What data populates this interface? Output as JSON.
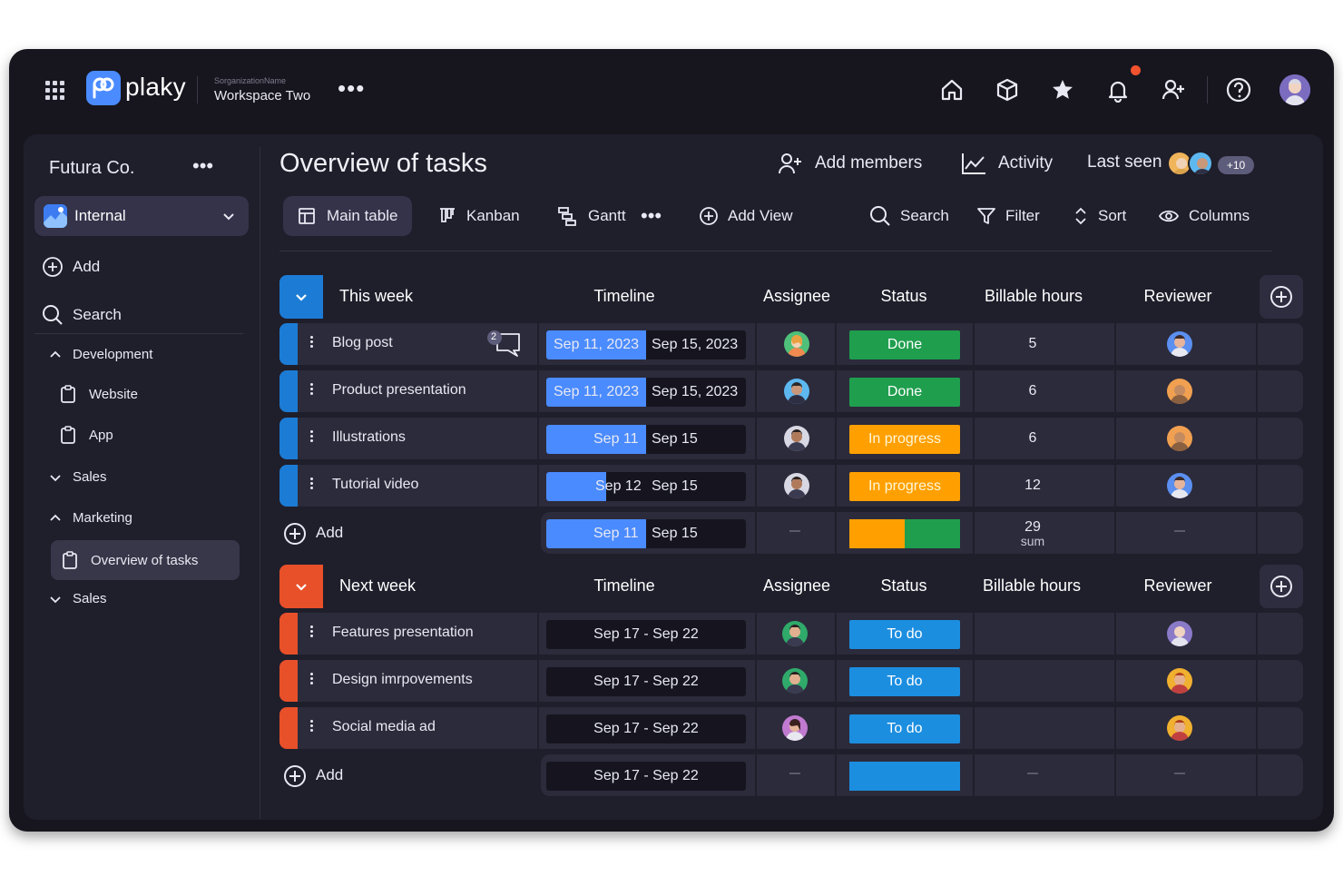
{
  "colors": {
    "accent": "#4a8bff",
    "this_week": "#1c7cd5",
    "next_week": "#e8502a",
    "done": "#1f9e4e",
    "in_progress": "#ffa000",
    "to_do": "#1c8ee0",
    "notification": "#f2522e"
  },
  "app": {
    "brand": "plaky",
    "org_label": "SorganizationName",
    "workspace_label": "Workspace Two",
    "more_icon": "more-horizontal-icon"
  },
  "topbar": {
    "icons": [
      "home-icon",
      "box-icon",
      "star-icon",
      "bell-icon",
      "add-user-icon",
      "help-icon",
      "profile-avatar"
    ]
  },
  "sidebar": {
    "company": "Futura Co.",
    "workspace": "Internal",
    "add_label": "Add",
    "search_label": "Search",
    "folders": [
      {
        "label": "Development",
        "state": "expanded",
        "boards": [
          "Website",
          "App"
        ]
      },
      {
        "label": "Sales",
        "state": "collapsed",
        "boards": []
      },
      {
        "label": "Marketing",
        "state": "expanded",
        "boards": [
          "Overview of tasks"
        ]
      },
      {
        "label": "Sales",
        "state": "collapsed",
        "boards": []
      }
    ],
    "active_board": "Overview of tasks"
  },
  "header": {
    "title": "Overview of tasks",
    "add_members": "Add members",
    "activity": "Activity",
    "last_seen": "Last seen",
    "last_seen_more": "+10"
  },
  "views": {
    "tabs": [
      {
        "label": "Main table",
        "active": true,
        "icon": "table-icon"
      },
      {
        "label": "Kanban",
        "active": false,
        "icon": "kanban-icon"
      },
      {
        "label": "Gantt",
        "active": false,
        "icon": "gantt-icon"
      }
    ],
    "add_view": "Add View",
    "search": "Search",
    "filter": "Filter",
    "sort": "Sort",
    "columns": "Columns"
  },
  "columns": {
    "timeline": "Timeline",
    "assignee": "Assignee",
    "status": "Status",
    "billable": "Billable hours",
    "reviewer": "Reviewer"
  },
  "groups": [
    {
      "name": "This week",
      "rows": [
        {
          "name": "Blog post",
          "comments": "2",
          "timeline_start": "Sep 11, 2023",
          "timeline_end": "Sep 15, 2023",
          "timeline_progress": 0.5,
          "status": "Done",
          "hours": "5"
        },
        {
          "name": "Product presentation",
          "timeline_start": "Sep 11, 2023",
          "timeline_end": "Sep 15, 2023",
          "timeline_progress": 0.5,
          "status": "Done",
          "hours": "6"
        },
        {
          "name": "Illustrations",
          "timeline_start": "Sep 11",
          "timeline_end": "Sep 15",
          "timeline_progress": 0.5,
          "status": "In progress",
          "hours": "6"
        },
        {
          "name": "Tutorial video",
          "timeline_start": "Sep 12",
          "timeline_end": "Sep 15",
          "timeline_progress": 0.3,
          "status": "In progress",
          "hours": "12"
        }
      ],
      "summary": {
        "add": "Add",
        "timeline_start": "Sep 11",
        "timeline_end": "Sep 15",
        "status_split": [
          0.5,
          0.5
        ],
        "hours_total": "29",
        "hours_label": "sum"
      }
    },
    {
      "name": "Next week",
      "rows": [
        {
          "name": "Features presentation",
          "timeline": "Sep 17 - Sep 22",
          "status": "To do"
        },
        {
          "name": "Design imrpovements",
          "timeline": "Sep 17 - Sep 22",
          "status": "To do"
        },
        {
          "name": "Social media ad",
          "timeline": "Sep 17 - Sep 22",
          "status": "To do"
        }
      ],
      "summary": {
        "add": "Add",
        "timeline": "Sep 17 - Sep 22"
      }
    }
  ]
}
